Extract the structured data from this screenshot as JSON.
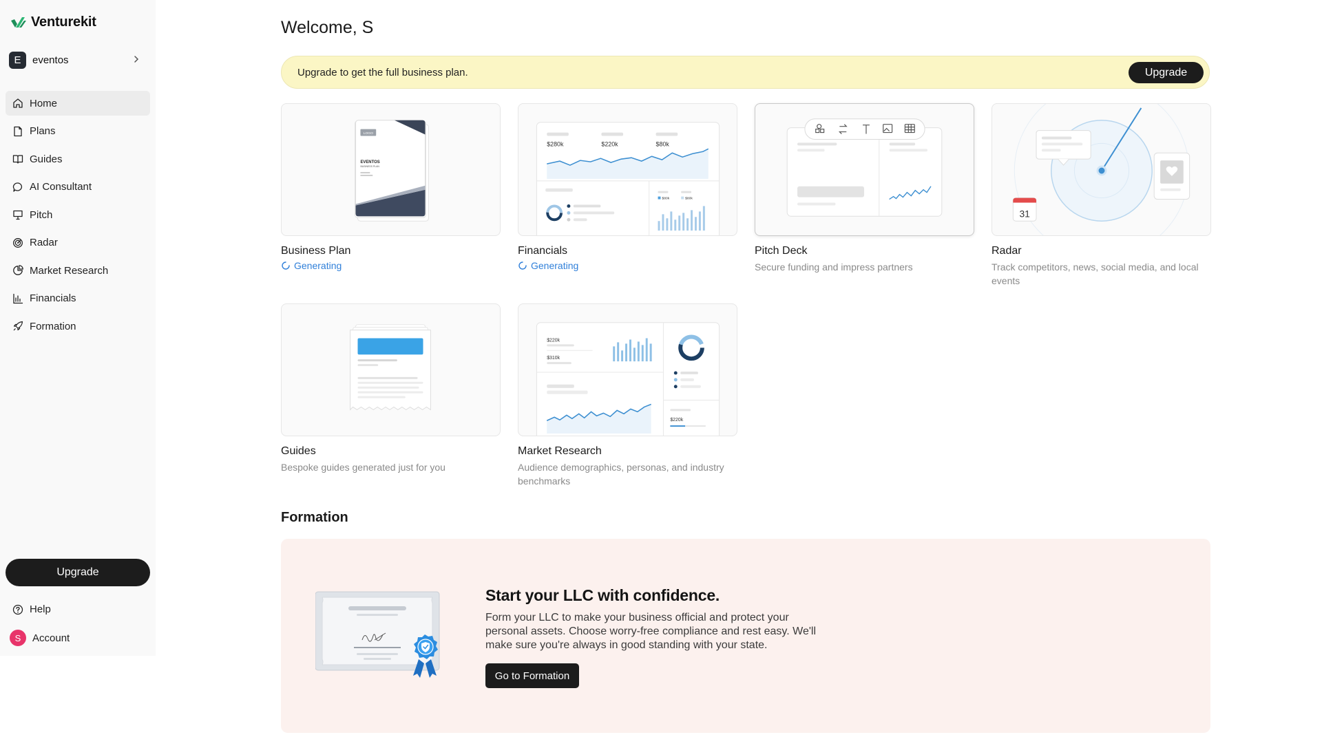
{
  "app": {
    "name": "Venturekit"
  },
  "workspace": {
    "initial": "E",
    "name": "eventos"
  },
  "nav": [
    {
      "label": "Home",
      "icon": "home-icon",
      "active": true
    },
    {
      "label": "Plans",
      "icon": "document-icon"
    },
    {
      "label": "Guides",
      "icon": "book-icon"
    },
    {
      "label": "AI Consultant",
      "icon": "chat-bubble-icon"
    },
    {
      "label": "Pitch",
      "icon": "presentation-icon"
    },
    {
      "label": "Radar",
      "icon": "radar-icon"
    },
    {
      "label": "Market Research",
      "icon": "pie-chart-icon"
    },
    {
      "label": "Financials",
      "icon": "bar-chart-icon"
    },
    {
      "label": "Formation",
      "icon": "rocket-icon"
    }
  ],
  "sidebar_footer": {
    "upgrade_label": "Upgrade",
    "help_label": "Help",
    "account_label": "Account",
    "account_initial": "S"
  },
  "main": {
    "welcome": "Welcome, S",
    "banner": {
      "text": "Upgrade to get the full business plan.",
      "button": "Upgrade"
    },
    "cards": [
      {
        "title": "Business Plan",
        "status": "Generating",
        "thumb": {
          "logo": "LOGO",
          "doc_title": "EVENTOS",
          "doc_sub": "BUSINESS PLAN"
        }
      },
      {
        "title": "Financials",
        "status": "Generating",
        "thumb": {
          "metrics": [
            "$280k",
            "$220k",
            "$80k"
          ],
          "mini": [
            "$80k",
            "$80k"
          ]
        }
      },
      {
        "title": "Pitch Deck",
        "subtitle": "Secure funding and impress partners"
      },
      {
        "title": "Radar",
        "subtitle": "Track competitors, news, social media, and local events",
        "thumb": {
          "calendar_day": "31"
        }
      },
      {
        "title": "Guides",
        "subtitle": "Bespoke guides generated just for you"
      },
      {
        "title": "Market Research",
        "subtitle": "Audience demographics, personas, and industry benchmarks",
        "thumb": {
          "metrics": [
            "$220k",
            "$310k",
            "$220k"
          ]
        }
      }
    ],
    "formation": {
      "section_title": "Formation",
      "headline": "Start your LLC with confidence.",
      "body": "Form your LLC to make your business official and protect your personal assets. Choose worry-free compliance and rest easy. We'll make sure you're always in good standing with your state.",
      "button": "Go to Formation"
    }
  },
  "colors": {
    "accent_blue": "#2f7fd9",
    "banner_bg": "#fbf6c5",
    "formation_bg": "#fcf1ee",
    "dark": "#1c1c1c"
  }
}
